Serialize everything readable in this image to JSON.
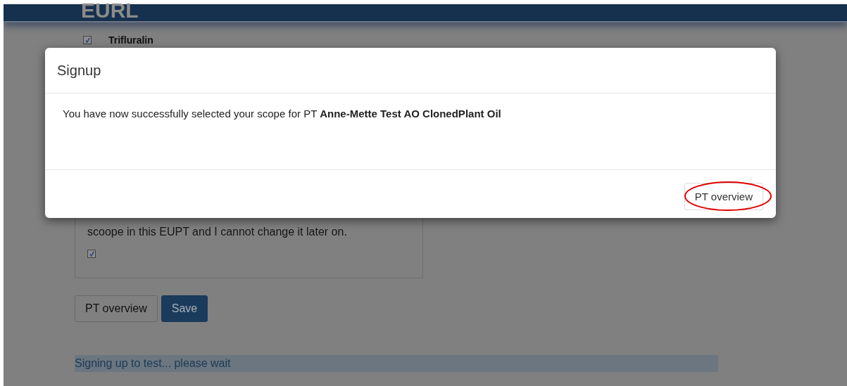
{
  "header": {
    "logo": "EURL"
  },
  "compounds": [
    {
      "name": "Trifluralin",
      "checked": true
    }
  ],
  "acceptance": {
    "text": "scoope in this EUPT and I cannot change it later on.",
    "checked": true
  },
  "buttons": [
    {
      "label": "PT overview",
      "kind": "default"
    },
    {
      "label": "Save",
      "kind": "primary"
    }
  ],
  "status": "Signing up to test... please wait",
  "modal": {
    "title": "Signup",
    "message": "You have now successfully selected your scope for PT **Anne-Mette Test AO ClonedPlant Oil**",
    "button": "PT overview",
    "highlighted": true
  }
}
